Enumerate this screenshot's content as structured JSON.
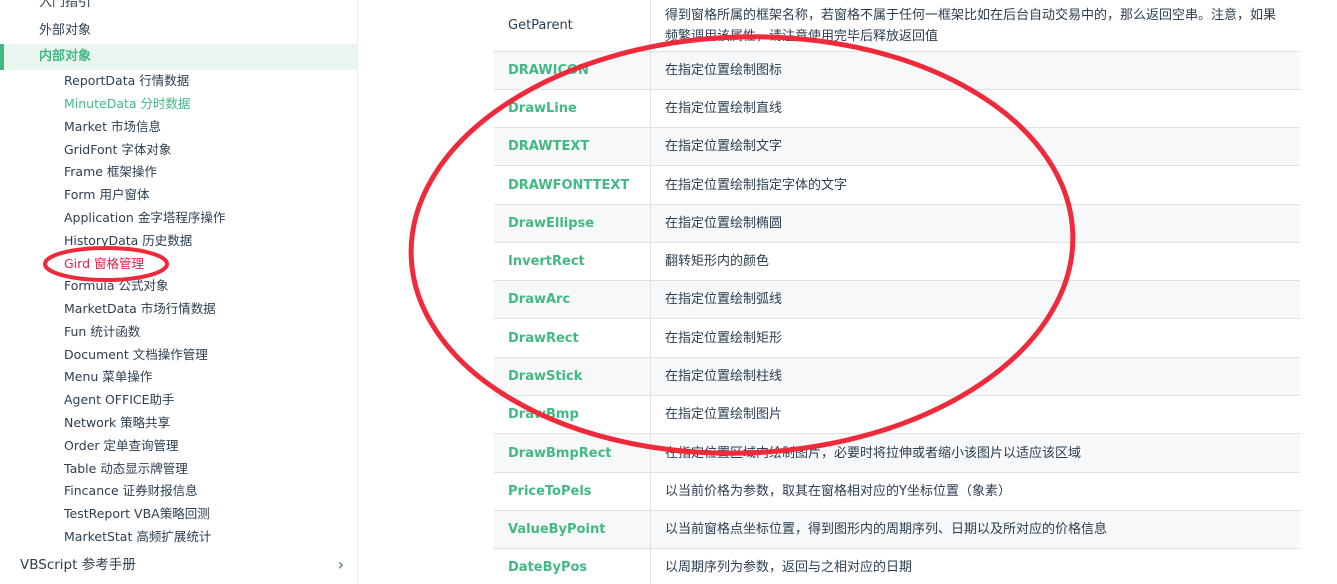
{
  "sidebar": {
    "top_items": [
      "入门指引",
      "外部对象"
    ],
    "active_item": "内部对象",
    "sub_items": [
      "ReportData 行情数据",
      "MinuteData 分时数据",
      "Market 市场信息",
      "GridFont 字体对象",
      "Frame 框架操作",
      "Form 用户窗体",
      "Application 金字塔程序操作",
      "HistoryData 历史数据",
      "Gird 窗格管理",
      "Formula 公式对象",
      "MarketData 市场行情数据",
      "Fun 统计函数",
      "Document 文档操作管理",
      "Menu 菜单操作",
      "Agent OFFICE助手",
      "Network 策略共享",
      "Order 定单查询管理",
      "Table 动态显示牌管理",
      "Fincance 证券财报信息",
      "TestReport VBA策略回测",
      "MarketStat 高频扩展统计"
    ],
    "section": "VBScript 参考手册",
    "section_icon": "chevron-right-icon"
  },
  "table": {
    "rows": [
      {
        "name": "GetParent",
        "desc": "得到窗格所属的框架名称，若窗格不属于任何一框架比如在后台自动交易中的，那么返回空串。注意，如果频繁调用该属性，请注意使用完毕后释放返回值"
      },
      {
        "name": "DRAWICON",
        "desc": "在指定位置绘制图标"
      },
      {
        "name": "DrawLine",
        "desc": "在指定位置绘制直线"
      },
      {
        "name": "DRAWTEXT",
        "desc": "在指定位置绘制文字"
      },
      {
        "name": "DRAWFONTTEXT",
        "desc": "在指定位置绘制指定字体的文字"
      },
      {
        "name": "DrawEllipse",
        "desc": "在指定位置绘制椭圆"
      },
      {
        "name": "InvertRect",
        "desc": "翻转矩形内的颜色"
      },
      {
        "name": "DrawArc",
        "desc": "在指定位置绘制弧线"
      },
      {
        "name": "DrawRect",
        "desc": "在指定位置绘制矩形"
      },
      {
        "name": "DrawStick",
        "desc": "在指定位置绘制柱线"
      },
      {
        "name": "DrawBmp",
        "desc": "在指定位置绘制图片"
      },
      {
        "name": "DrawBmpRect",
        "desc": "在指定位置区域内绘制图片，必要时将拉伸或者缩小该图片以适应该区域"
      },
      {
        "name": "PriceToPels",
        "desc": "以当前价格为参数，取其在窗格相对应的Y坐标位置（象素）"
      },
      {
        "name": "ValueByPoint",
        "desc": "以当前窗格点坐标位置，得到图形内的周期序列、日期以及所对应的价格信息"
      },
      {
        "name": "DateByPos",
        "desc": "以周期序列为参数，返回与之相对应的日期"
      }
    ]
  },
  "colors": {
    "accent": "#42b983",
    "annotation": "#f02a3a",
    "text": "#2c3e50"
  }
}
